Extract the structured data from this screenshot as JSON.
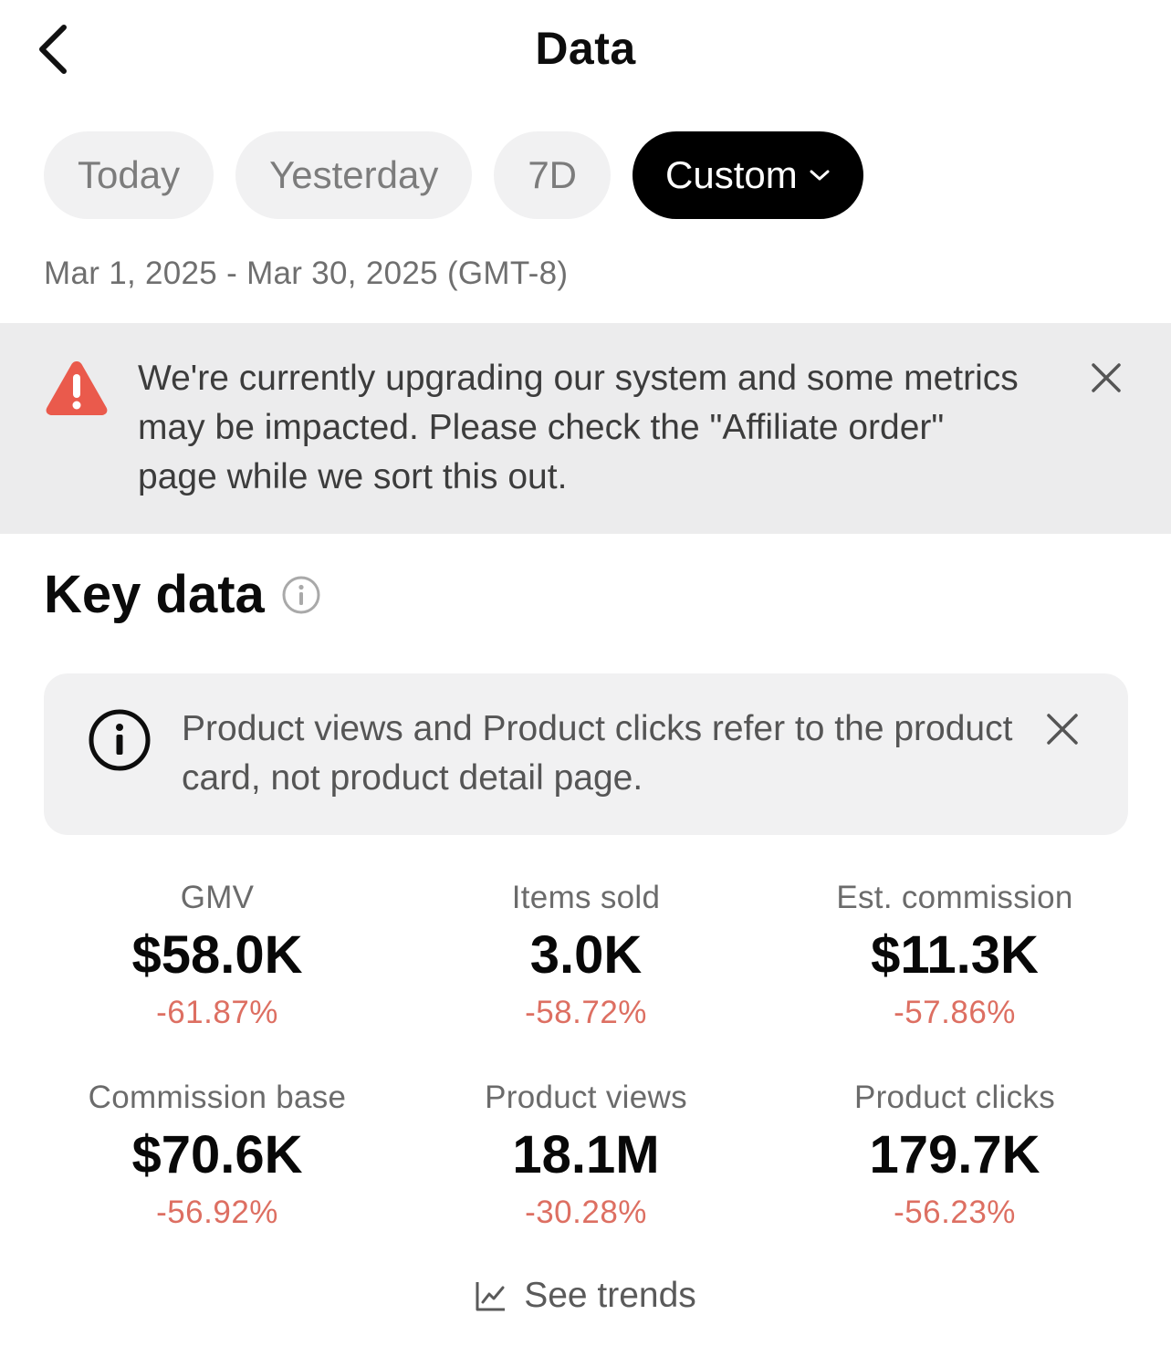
{
  "header": {
    "title": "Data"
  },
  "date_filters": {
    "chips": [
      {
        "label": "Today"
      },
      {
        "label": "Yesterday"
      },
      {
        "label": "7D"
      },
      {
        "label": "Custom"
      }
    ],
    "selected": "Custom",
    "range_text": "Mar 1, 2025 - Mar 30, 2025 (GMT-8)"
  },
  "warning_banner": {
    "icon": "warning-triangle-icon",
    "text": "We're currently upgrading our system and some metrics may be impacted. Please check the \"Affiliate order\" page while we sort this out."
  },
  "key_data": {
    "title": "Key data",
    "info_card": {
      "text": "Product views and Product clicks refer to the product card, not product detail page."
    },
    "metrics": [
      {
        "label": "GMV",
        "value": "$58.0K",
        "change": "-61.87%"
      },
      {
        "label": "Items sold",
        "value": "3.0K",
        "change": "-58.72%"
      },
      {
        "label": "Est. commission",
        "value": "$11.3K",
        "change": "-57.86%"
      },
      {
        "label": "Commission base",
        "value": "$70.6K",
        "change": "-56.92%"
      },
      {
        "label": "Product views",
        "value": "18.1M",
        "change": "-30.28%"
      },
      {
        "label": "Product clicks",
        "value": "179.7K",
        "change": "-56.23%"
      }
    ],
    "see_trends_label": "See trends"
  },
  "colors": {
    "negative_change": "#dd6f62",
    "warning_icon": "#ea5a4c",
    "chip_active_bg": "#000000",
    "chip_bg": "#f1f1f2"
  }
}
